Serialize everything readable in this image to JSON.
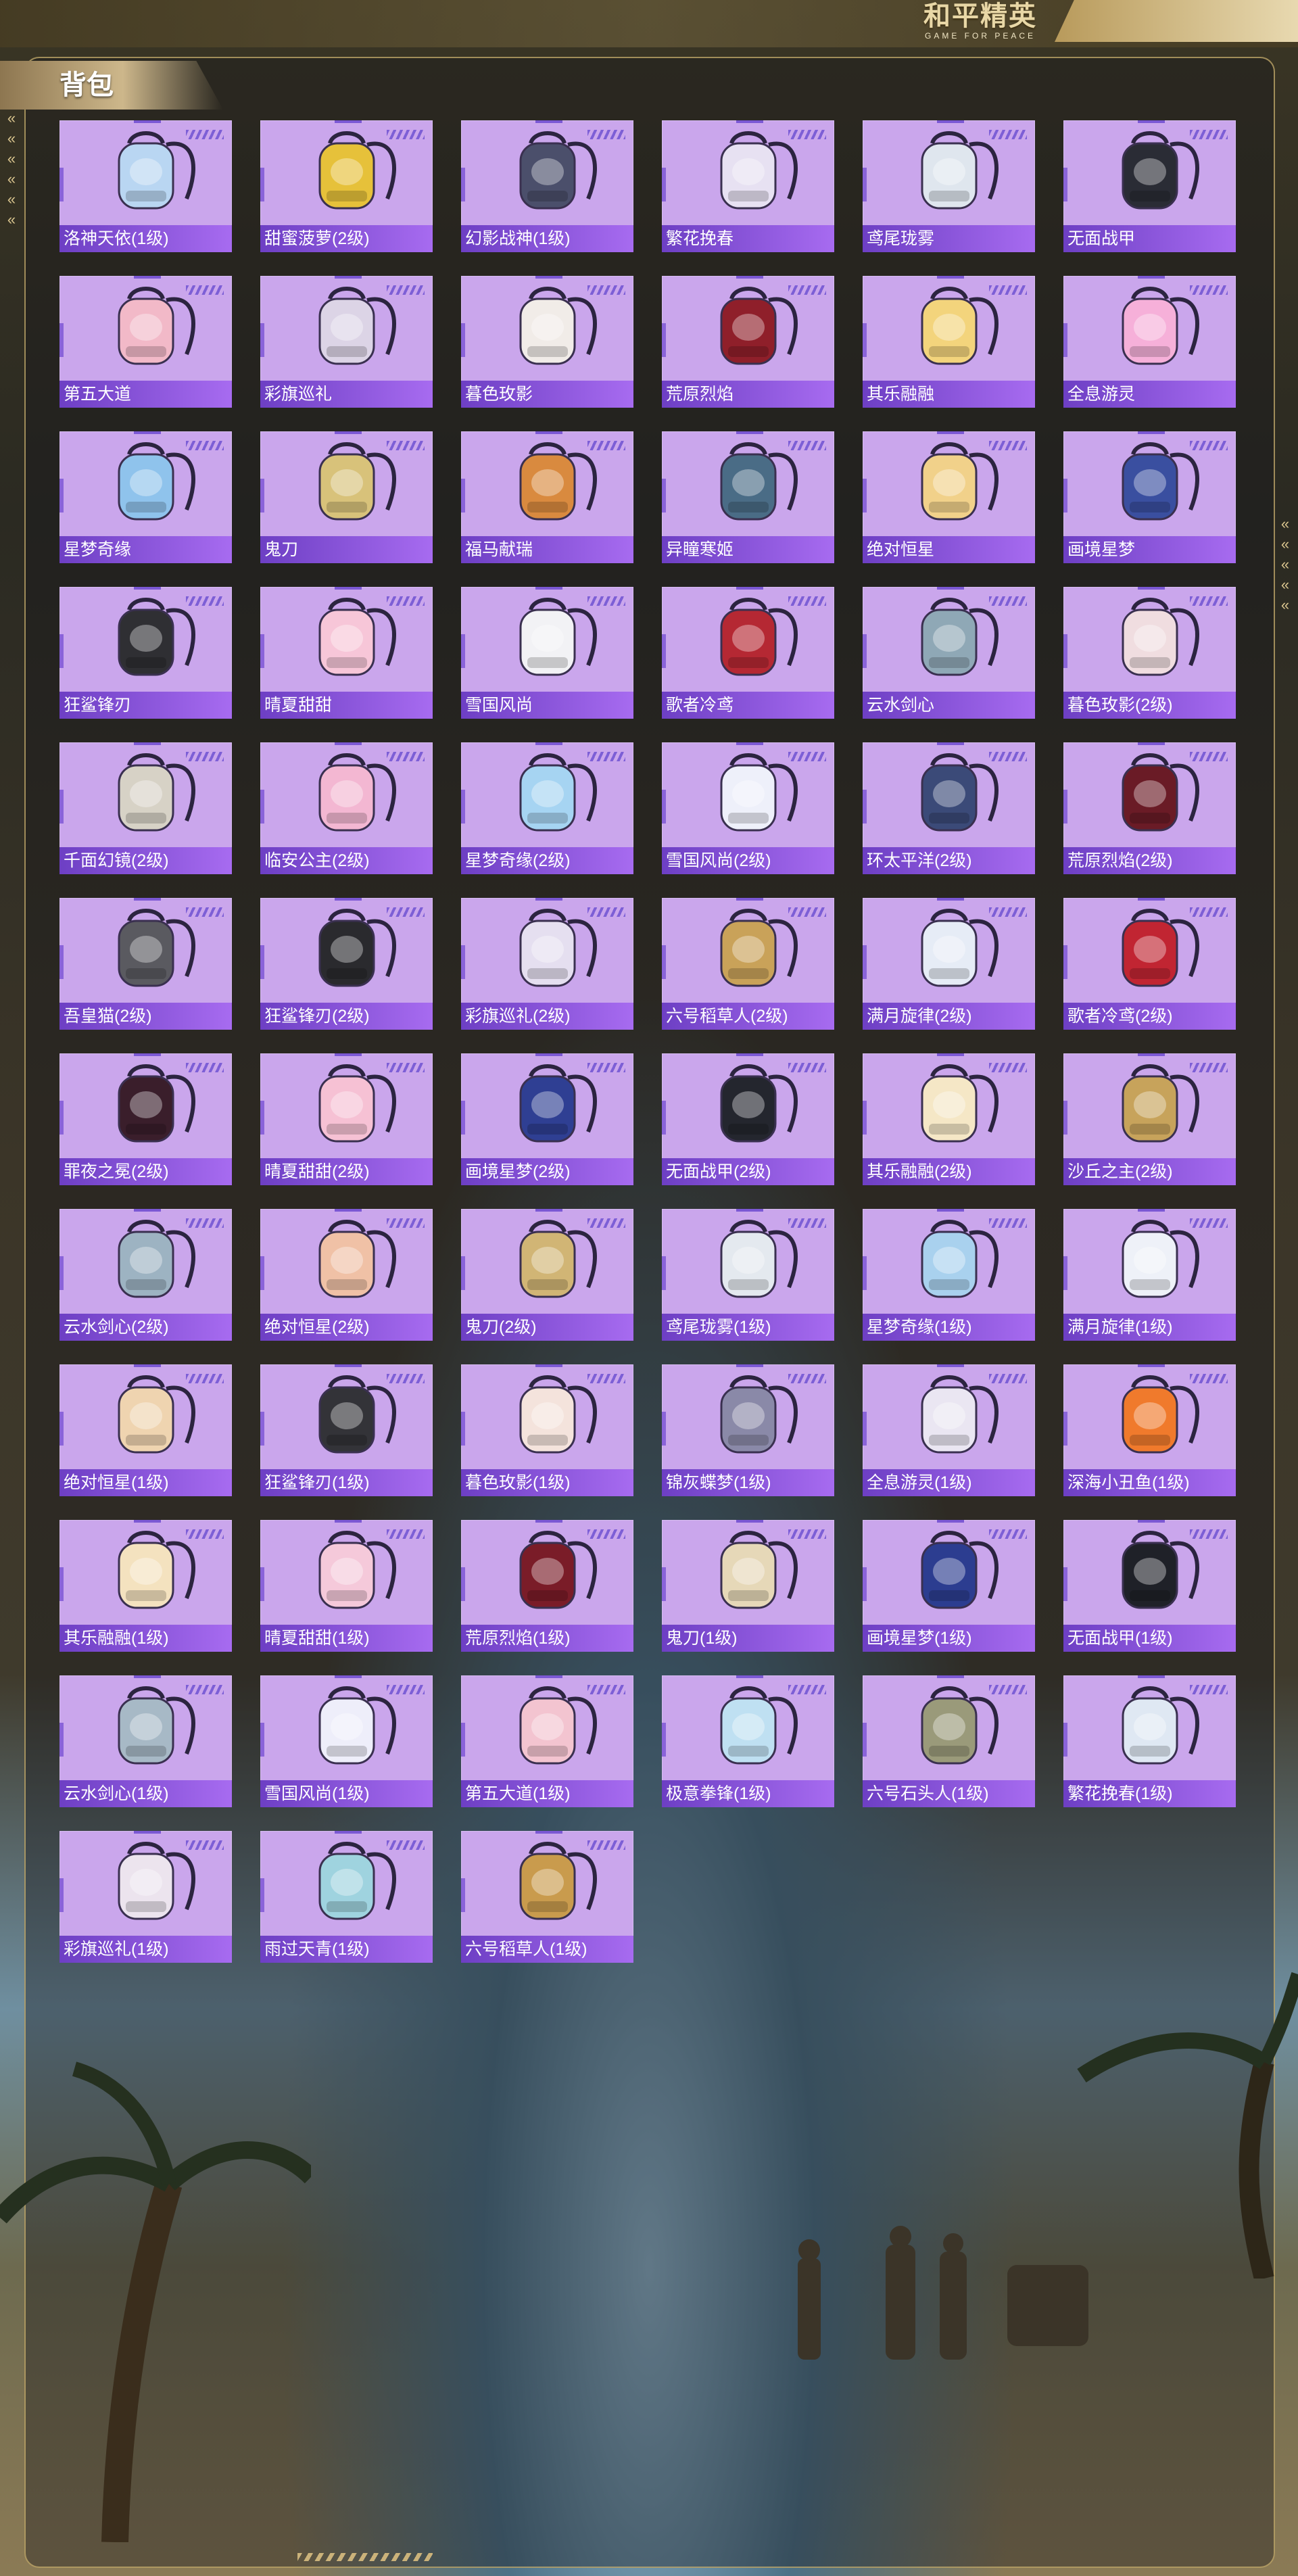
{
  "header": {
    "logo_main": "和平精英",
    "logo_sub": "GAME FOR PEACE",
    "tab_title": "背包"
  },
  "colors": {
    "card_bg": "#caa6ec",
    "label_band": "#8a55de",
    "frame_gold": "#c8af6e"
  },
  "backpacks": [
    {
      "name": "洛神天依(1级)",
      "icon": "pink-cat-backpack-icon",
      "color": "#b9d6f2"
    },
    {
      "name": "甜蜜菠萝(2级)",
      "icon": "pineapple-backpack-icon",
      "color": "#e6c13a"
    },
    {
      "name": "幻影战神(1级)",
      "icon": "phantom-armor-backpack-icon",
      "color": "#4b4f6b"
    },
    {
      "name": "繁花挽春",
      "icon": "flower-bag-icon",
      "color": "#e7e1f2"
    },
    {
      "name": "鸢尾珑雾",
      "icon": "iris-bag-icon",
      "color": "#dfe6ee"
    },
    {
      "name": "无面战甲",
      "icon": "faceless-armor-backpack-icon",
      "color": "#2a2c35"
    },
    {
      "name": "第五大道",
      "icon": "pink-handbag-icon",
      "color": "#f2b9c8"
    },
    {
      "name": "彩旗巡礼",
      "icon": "banner-bag-icon",
      "color": "#dcd4e6"
    },
    {
      "name": "暮色玫影",
      "icon": "rose-doll-backpack-icon",
      "color": "#f1ece8"
    },
    {
      "name": "荒原烈焰",
      "icon": "flame-backpack-icon",
      "color": "#8f1f2a"
    },
    {
      "name": "其乐融融",
      "icon": "cupcake-bag-icon",
      "color": "#f3d47c"
    },
    {
      "name": "全息游灵",
      "icon": "holo-bottle-bag-icon",
      "color": "#f6b0d9"
    },
    {
      "name": "星梦奇缘",
      "icon": "swan-backpack-icon",
      "color": "#8fc3ec"
    },
    {
      "name": "鬼刀",
      "icon": "ghost-blade-backpack-icon",
      "color": "#d8c27a"
    },
    {
      "name": "福马献瑞",
      "icon": "horse-backpack-icon",
      "color": "#d98a3f"
    },
    {
      "name": "异瞳寒姬",
      "icon": "bunny-backpack-icon",
      "color": "#4a6c86"
    },
    {
      "name": "绝对恒星",
      "icon": "popcorn-bag-icon",
      "color": "#f1d18a"
    },
    {
      "name": "画境星梦",
      "icon": "star-frame-backpack-icon",
      "color": "#3a4fa0"
    },
    {
      "name": "狂鲨锋刃",
      "icon": "shark-backpack-icon",
      "color": "#2f2f33"
    },
    {
      "name": "晴夏甜甜",
      "icon": "pink-bunny-bag-icon",
      "color": "#f7c6d8"
    },
    {
      "name": "雪国风尚",
      "icon": "snow-penguin-backpack-icon",
      "color": "#f2f2f5"
    },
    {
      "name": "歌者冷鸢",
      "icon": "red-pouch-backpack-icon",
      "color": "#b52833"
    },
    {
      "name": "云水剑心",
      "icon": "sword-bag-icon",
      "color": "#8fa8b6"
    },
    {
      "name": "暮色玫影(2级)",
      "icon": "rose-doll-backpack-icon",
      "color": "#f0dde0"
    },
    {
      "name": "千面幻镜(2级)",
      "icon": "mirror-backpack-icon",
      "color": "#d7d2c6"
    },
    {
      "name": "临安公主(2级)",
      "icon": "pink-flower-bag-icon",
      "color": "#f3b7d2"
    },
    {
      "name": "星梦奇缘(2级)",
      "icon": "swan-backpack-icon",
      "color": "#a6d4f2"
    },
    {
      "name": "雪国风尚(2级)",
      "icon": "snow-penguin-backpack-icon",
      "color": "#eef0fa"
    },
    {
      "name": "环太平洋(2级)",
      "icon": "mecha-backpack-icon",
      "color": "#3b4a78"
    },
    {
      "name": "荒原烈焰(2级)",
      "icon": "flame-backpack-icon",
      "color": "#6a1b26"
    },
    {
      "name": "吾皇猫(2级)",
      "icon": "cat-backpack-icon",
      "color": "#5a5a60"
    },
    {
      "name": "狂鲨锋刃(2级)",
      "icon": "shark-backpack-icon",
      "color": "#2a2a2e"
    },
    {
      "name": "彩旗巡礼(2级)",
      "icon": "banner-bag-icon",
      "color": "#e5dff0"
    },
    {
      "name": "六号稻草人(2级)",
      "icon": "scarecrow-backpack-icon",
      "color": "#c9a259"
    },
    {
      "name": "满月旋律(2级)",
      "icon": "moon-bag-icon",
      "color": "#e6ecf6"
    },
    {
      "name": "歌者冷鸢(2级)",
      "icon": "red-pouch-backpack-icon",
      "color": "#c12532"
    },
    {
      "name": "罪夜之冕(2级)",
      "icon": "crown-night-backpack-icon",
      "color": "#3a1e2b"
    },
    {
      "name": "晴夏甜甜(2级)",
      "icon": "pink-bunny-bag-icon",
      "color": "#f6c1d4"
    },
    {
      "name": "画境星梦(2级)",
      "icon": "star-frame-backpack-icon",
      "color": "#2f3f93"
    },
    {
      "name": "无面战甲(2级)",
      "icon": "faceless-armor-backpack-icon",
      "color": "#24262e"
    },
    {
      "name": "其乐融融(2级)",
      "icon": "cupcake-bag-icon",
      "color": "#f5e7c6"
    },
    {
      "name": "沙丘之主(2级)",
      "icon": "dune-lord-bag-icon",
      "color": "#c7a35b"
    },
    {
      "name": "云水剑心(2级)",
      "icon": "sword-bag-icon",
      "color": "#9db3c2"
    },
    {
      "name": "绝对恒星(2级)",
      "icon": "popcorn-bag-icon",
      "color": "#f0c1a6"
    },
    {
      "name": "鬼刀(2级)",
      "icon": "ghost-blade-backpack-icon",
      "color": "#d1b575"
    },
    {
      "name": "鸢尾珑雾(1级)",
      "icon": "iris-bag-icon",
      "color": "#e4e9ef"
    },
    {
      "name": "星梦奇缘(1级)",
      "icon": "swan-backpack-icon",
      "color": "#a9d1ee"
    },
    {
      "name": "满月旋律(1级)",
      "icon": "moon-bag-icon",
      "color": "#eef1f8"
    },
    {
      "name": "绝对恒星(1级)",
      "icon": "popcorn-bag-icon",
      "color": "#efd4b0"
    },
    {
      "name": "狂鲨锋刃(1级)",
      "icon": "shark-backpack-icon",
      "color": "#333338"
    },
    {
      "name": "暮色玫影(1级)",
      "icon": "bat-doll-backpack-icon",
      "color": "#f4e3dc"
    },
    {
      "name": "锦灰蝶梦(1级)",
      "icon": "butterfly-bag-icon",
      "color": "#8a89a8"
    },
    {
      "name": "全息游灵(1级)",
      "icon": "gamepad-bag-icon",
      "color": "#eae6f2"
    },
    {
      "name": "深海小丑鱼(1级)",
      "icon": "clownfish-backpack-icon",
      "color": "#f07a2c"
    },
    {
      "name": "其乐融融(1级)",
      "icon": "cupcake-bag-icon",
      "color": "#f4e2bf"
    },
    {
      "name": "晴夏甜甜(1级)",
      "icon": "pink-bunny-bag-icon",
      "color": "#f5c9da"
    },
    {
      "name": "荒原烈焰(1级)",
      "icon": "flame-backpack-icon",
      "color": "#7a1c28"
    },
    {
      "name": "鬼刀(1级)",
      "icon": "ghost-blade-backpack-icon",
      "color": "#e6d8b8"
    },
    {
      "name": "画境星梦(1级)",
      "icon": "star-frame-backpack-icon",
      "color": "#2c3d90"
    },
    {
      "name": "无面战甲(1级)",
      "icon": "faceless-armor-backpack-icon",
      "color": "#1f2128"
    },
    {
      "name": "云水剑心(1级)",
      "icon": "sword-bag-icon",
      "color": "#a7b9c6"
    },
    {
      "name": "雪国风尚(1级)",
      "icon": "snow-penguin-backpack-icon",
      "color": "#eeeefa"
    },
    {
      "name": "第五大道(1级)",
      "icon": "pink-handbag-icon",
      "color": "#f3c4d0"
    },
    {
      "name": "极意拳锋(1级)",
      "icon": "fist-cup-bag-icon",
      "color": "#bfe0f2"
    },
    {
      "name": "六号石头人(1级)",
      "icon": "stone-man-bag-icon",
      "color": "#9a9a7a"
    },
    {
      "name": "繁花挽春(1级)",
      "icon": "flower-bag-icon",
      "color": "#dfe8f3"
    },
    {
      "name": "彩旗巡礼(1级)",
      "icon": "banner-bag-icon",
      "color": "#ece4ee"
    },
    {
      "name": "雨过天青(1级)",
      "icon": "celadon-bag-icon",
      "color": "#9fd3df"
    },
    {
      "name": "六号稻草人(1级)",
      "icon": "scarecrow-backpack-icon",
      "color": "#c99b4d"
    }
  ]
}
